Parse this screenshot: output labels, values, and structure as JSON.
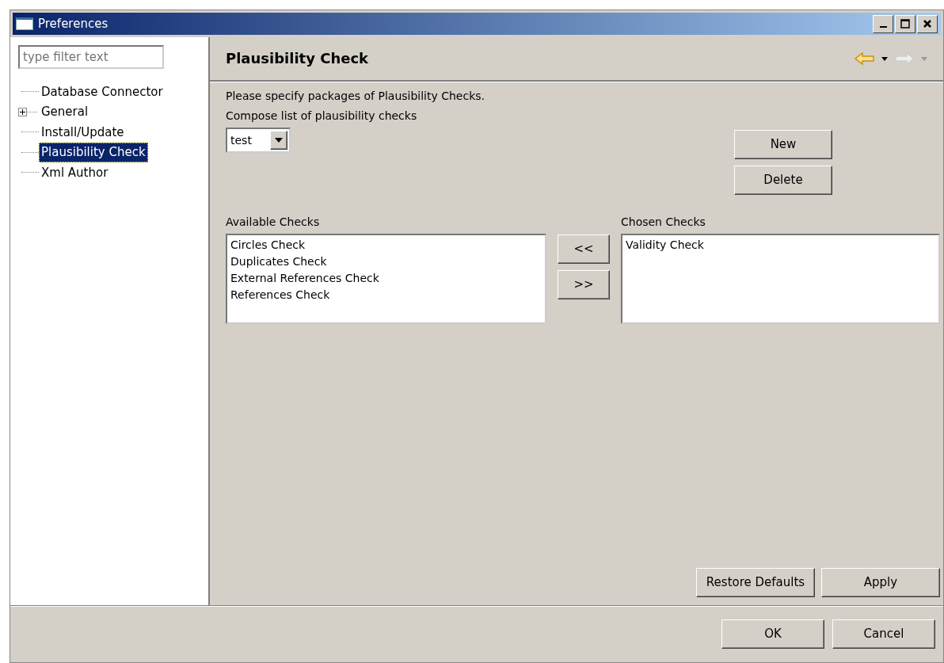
{
  "window": {
    "title": "Preferences"
  },
  "filter": {
    "placeholder": "type filter text"
  },
  "tree": [
    {
      "label": "Database Connector",
      "kind": "leaf",
      "selected": false
    },
    {
      "label": "General",
      "kind": "folder",
      "expanded": false,
      "selected": false
    },
    {
      "label": "Install/Update",
      "kind": "leaf",
      "selected": false
    },
    {
      "label": "Plausibility Check",
      "kind": "leaf",
      "selected": true
    },
    {
      "label": "Xml Author",
      "kind": "leaf",
      "selected": false
    }
  ],
  "page": {
    "title": "Plausibility Check",
    "description": "Please specify packages of Plausibility Checks.",
    "compose_label": "Compose list of plausibility checks",
    "compose_value": "test",
    "side_buttons": [
      "New",
      "Delete"
    ],
    "available": {
      "label": "Available Checks",
      "items": [
        "Circles Check",
        "Duplicates Check",
        "External References Check",
        "References Check"
      ]
    },
    "move_buttons": [
      "<<",
      ">>"
    ],
    "chosen": {
      "label": "Chosen Checks",
      "items": [
        "Validity Check"
      ]
    },
    "page_buttons": [
      "Restore Defaults",
      "Apply"
    ]
  },
  "dialog_buttons": [
    "OK",
    "Cancel"
  ]
}
